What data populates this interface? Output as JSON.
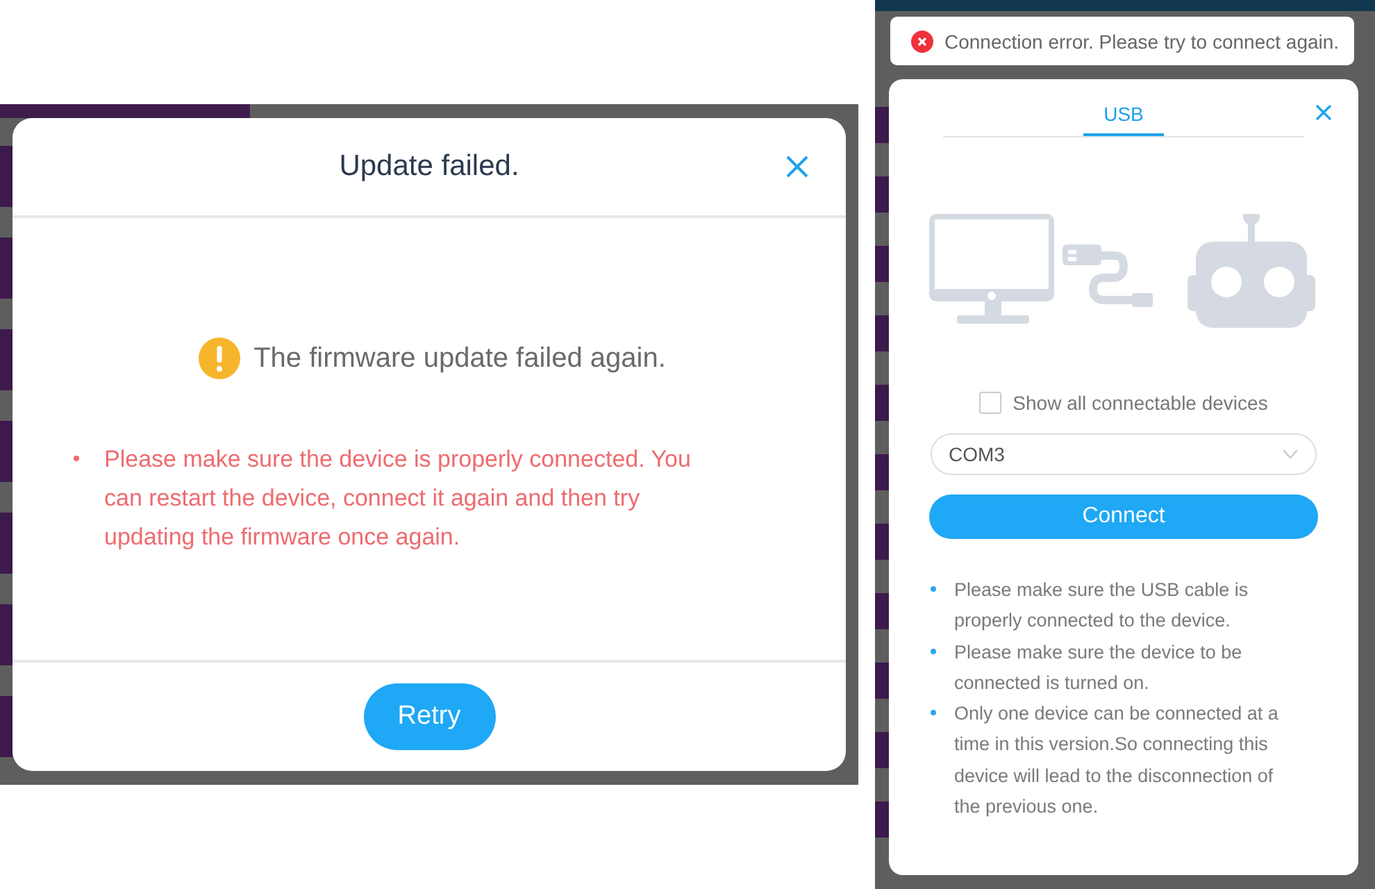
{
  "update_dialog": {
    "title": "Update failed.",
    "message": "The firmware update failed again.",
    "notes": [
      "Please make sure the device is properly connected. You can restart the device, connect it again and then try updating the firmware once again."
    ],
    "buttons": [
      "Retry"
    ]
  },
  "toast": {
    "kind": "error",
    "message": "Connection error. Please try to connect again."
  },
  "connect_dialog": {
    "tabs": [
      {
        "label": "USB",
        "selected": true
      }
    ],
    "show_all": {
      "label": "Show all connectable devices",
      "checked": false
    },
    "port": {
      "value": "COM3"
    },
    "connect_button": "Connect",
    "tips": [
      "Please make sure the USB cable is properly connected to the device.",
      "Please make sure the device to be connected is turned on.",
      "Only one device can be connected at a time in this version.So connecting this device will lead to the disconnection of the previous one."
    ]
  }
}
